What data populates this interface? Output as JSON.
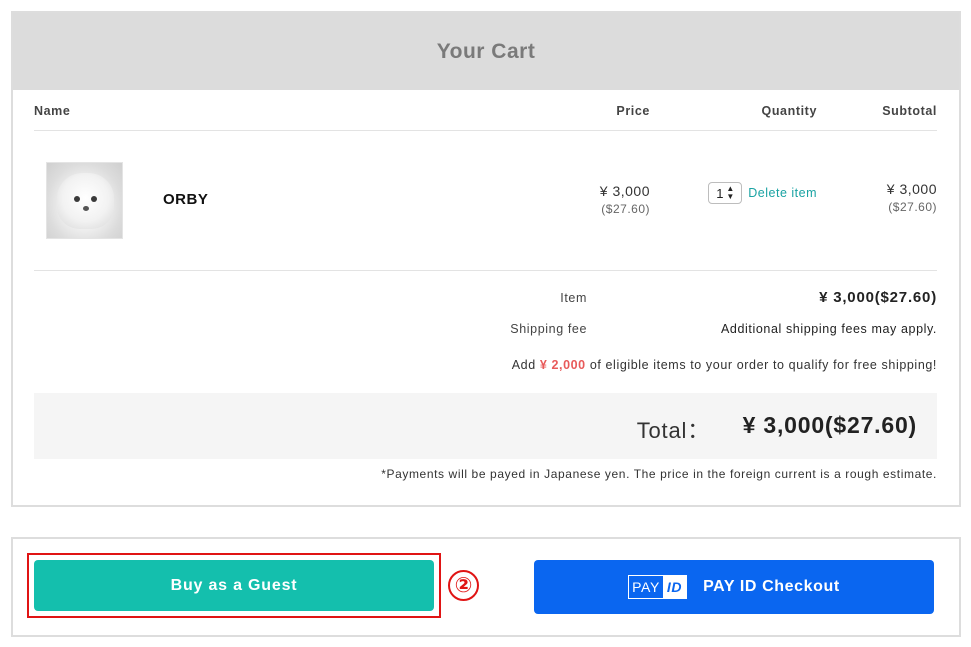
{
  "cart": {
    "title": "Your Cart",
    "columns": {
      "name": "Name",
      "price": "Price",
      "quantity": "Quantity",
      "subtotal": "Subtotal"
    },
    "items": [
      {
        "name": "ORBY",
        "image_icon": "plush-product-image",
        "price_yen": "¥ 3,000",
        "price_usd": "($27.60)",
        "quantity": "1",
        "delete_label": "Delete item",
        "subtotal_yen": "¥ 3,000",
        "subtotal_usd": "($27.60)"
      }
    ],
    "summary": {
      "item_label": "Item",
      "item_value": "¥ 3,000($27.60)",
      "shipping_label": "Shipping fee",
      "shipping_value": "Additional shipping fees may apply.",
      "notice_prefix": "Add",
      "notice_amount": "¥ 2,000",
      "notice_suffix": "of eligible items to your order to qualify for free shipping!",
      "notice_amount_color": "#e85a5a"
    },
    "total": {
      "label": "Total：",
      "value": "¥ 3,000($27.60)"
    },
    "footnote": "*Payments will be payed in Japanese yen. The price in the foreign current is a rough estimate."
  },
  "checkout": {
    "guest_label": "Buy as a Guest",
    "guest_color": "#14bfad",
    "step_marker": "②",
    "highlight_color": "#e01414",
    "payid_logo_left": "PAY",
    "payid_logo_right": "ID",
    "payid_label": "PAY ID Checkout",
    "payid_color": "#0a66f0"
  }
}
